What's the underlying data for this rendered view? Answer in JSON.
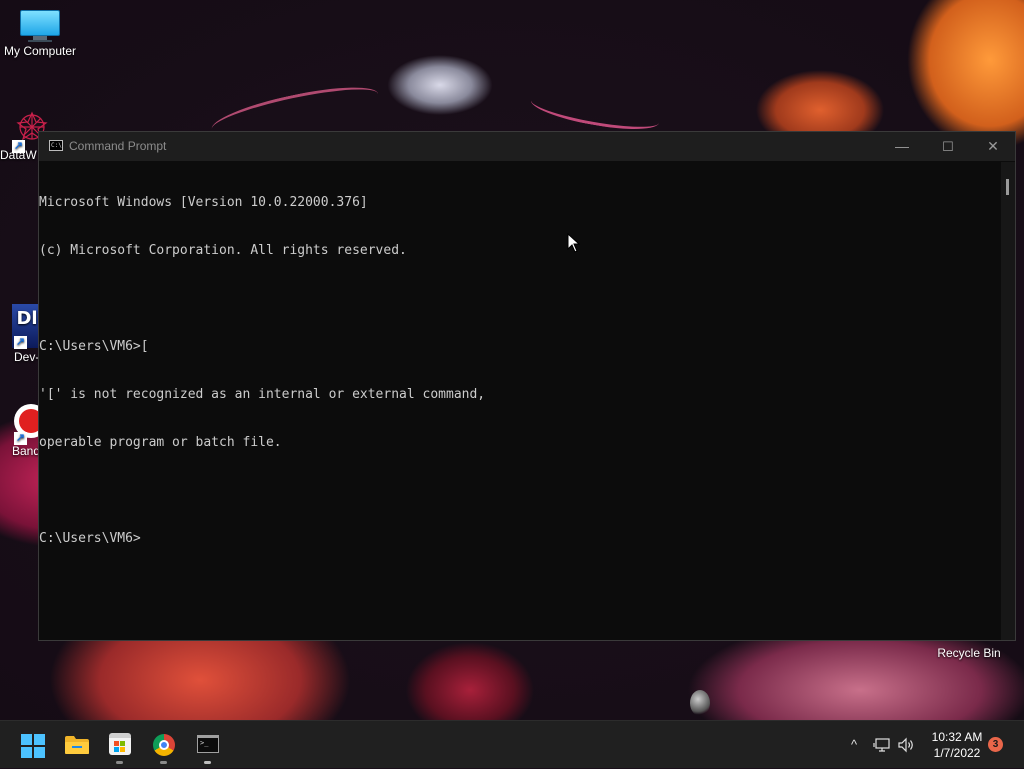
{
  "desktop": {
    "icons": [
      {
        "label": "My Computer",
        "icon": "monitor-icon"
      },
      {
        "label": "DataW",
        "icon": "datawave-icon"
      },
      {
        "label": "Dev-",
        "icon": "dev-icon"
      },
      {
        "label": "Band",
        "icon": "bandicam-icon"
      }
    ],
    "recycle_bin": {
      "label": "Recycle Bin"
    }
  },
  "window": {
    "title": "Command Prompt",
    "icon": "cmd-icon",
    "controls": {
      "minimize": "—",
      "maximize": "☐",
      "close": "✕"
    },
    "console_lines": [
      "Microsoft Windows [Version 10.0.22000.376]",
      "(c) Microsoft Corporation. All rights reserved.",
      "",
      "C:\\Users\\VM6>[",
      "'[' is not recognized as an internal or external command,",
      "operable program or batch file.",
      "",
      "C:\\Users\\VM6>"
    ]
  },
  "taskbar": {
    "apps": [
      {
        "name": "start",
        "icon": "windows-start-icon",
        "running": false
      },
      {
        "name": "file-explorer",
        "icon": "folder-icon",
        "running": false
      },
      {
        "name": "microsoft-store",
        "icon": "store-icon",
        "running": true
      },
      {
        "name": "chrome",
        "icon": "chrome-icon",
        "running": true
      },
      {
        "name": "command-prompt",
        "icon": "terminal-icon",
        "running": true
      }
    ],
    "tray": {
      "chevron": "^",
      "network_icon": "network-icon",
      "volume_icon": "volume-icon",
      "time": "10:32 AM",
      "date": "1/7/2022",
      "notification_count": "3"
    }
  },
  "colors": {
    "console_bg": "#0c0c0c",
    "console_text": "#cccccc",
    "titlebar_bg": "#1e1e1e",
    "taskbar_bg": "#202020",
    "accent": "#4cc2ff",
    "badge": "#e9664a"
  }
}
